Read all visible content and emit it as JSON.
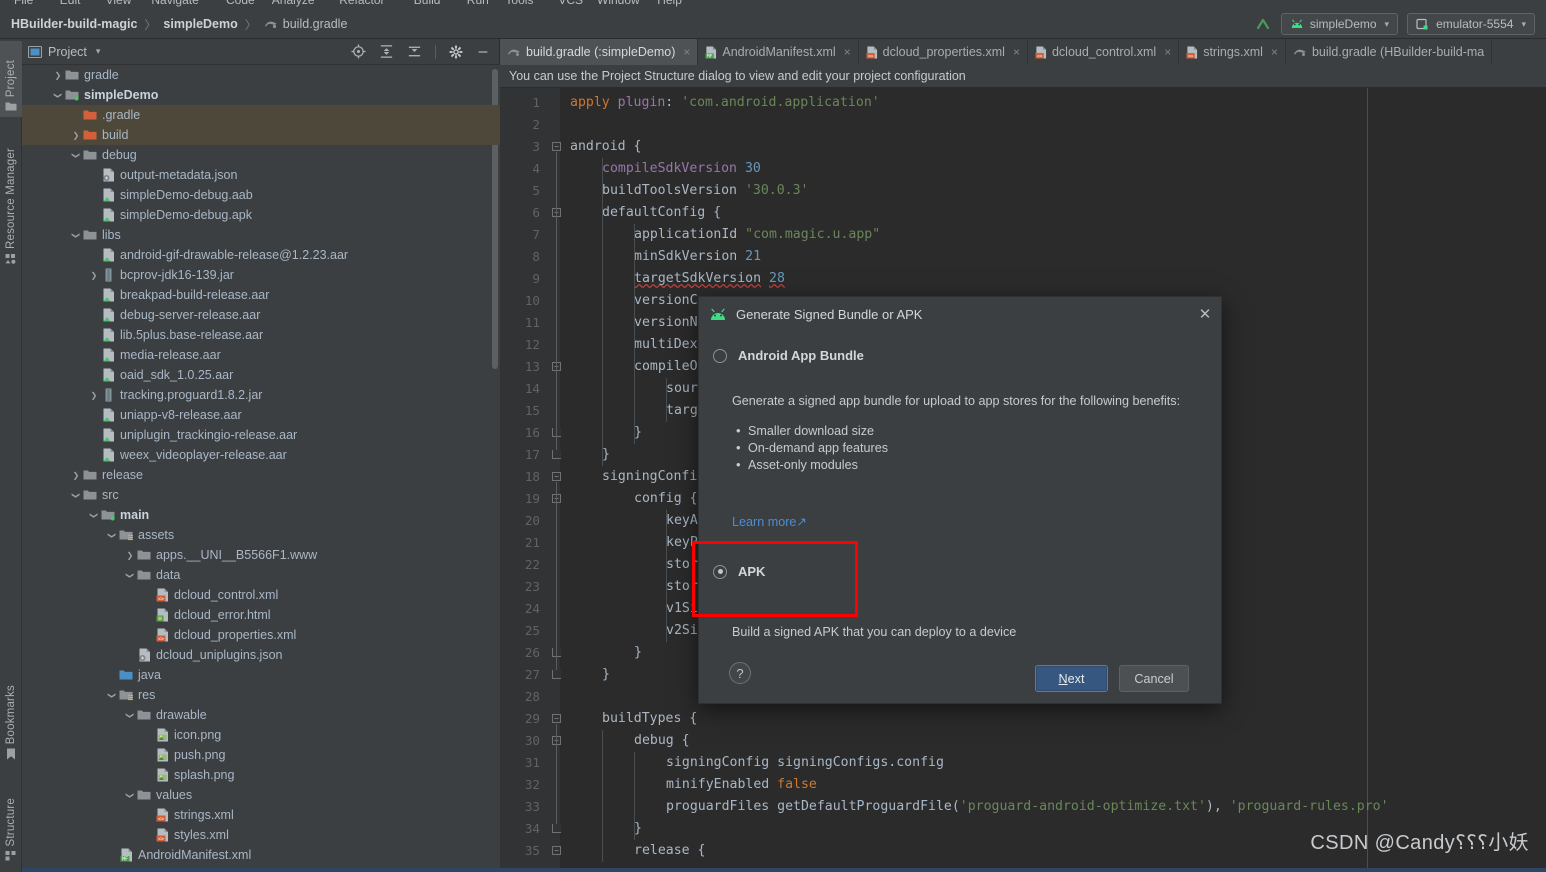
{
  "menu_sliver": [
    "File",
    "Edit",
    "View",
    "Navigate",
    "Code",
    "Analyze",
    "Refactor",
    "Build",
    "Run",
    "Tools",
    "VCS",
    "Window",
    "Help"
  ],
  "navbar": {
    "crumbs": [
      {
        "label": "HBuilder-build-magic",
        "bold": true,
        "icon": null
      },
      {
        "label": "simpleDemo",
        "bold": true,
        "icon": null
      },
      {
        "label": "build.gradle",
        "bold": false,
        "icon": "gradle-icon"
      }
    ],
    "separator": "〉",
    "run_icon": "run-arrow-icon",
    "app_selector": {
      "label": "simpleDemo",
      "icon": "android-icon",
      "caret": "▾"
    },
    "device_selector": {
      "label": "emulator-5554",
      "icon": "device-icon",
      "caret": "▾"
    }
  },
  "toolstrip": {
    "left_top": [
      {
        "label": "Project",
        "icon": "project-folder-icon",
        "active": true
      },
      {
        "label": "Resource Manager",
        "icon": "resource-manager-icon",
        "active": false
      }
    ],
    "left_bottom": [
      {
        "label": "Structure",
        "icon": "structure-icon",
        "active": false
      },
      {
        "label": "Bookmarks",
        "icon": "bookmark-icon",
        "active": false
      }
    ]
  },
  "project_panel": {
    "title": "Project",
    "caret": "▾",
    "view_icon": "project-view-icon",
    "header_icons": [
      "locate-icon",
      "expand-all-icon",
      "collapse-all-icon",
      "settings-gear-icon",
      "hide-panel-icon"
    ],
    "tree": [
      {
        "indent": 1,
        "arrow": "›",
        "icon": "folder",
        "label": "gradle",
        "bold": false,
        "selected": false
      },
      {
        "indent": 1,
        "arrow": "⌄",
        "icon": "module",
        "label": "simpleDemo",
        "bold": true,
        "selected": false
      },
      {
        "indent": 2,
        "arrow": "",
        "icon": "folder-orange",
        "label": ".gradle",
        "bold": false,
        "selected": true
      },
      {
        "indent": 2,
        "arrow": "›",
        "icon": "folder-orange",
        "label": "build",
        "bold": false,
        "selected": true
      },
      {
        "indent": 2,
        "arrow": "⌄",
        "icon": "folder",
        "label": "debug",
        "bold": false,
        "selected": false
      },
      {
        "indent": 3,
        "arrow": "",
        "icon": "json-file",
        "label": "output-metadata.json",
        "bold": false,
        "selected": false
      },
      {
        "indent": 3,
        "arrow": "",
        "icon": "aab-file",
        "label": "simpleDemo-debug.aab",
        "bold": false,
        "selected": false
      },
      {
        "indent": 3,
        "arrow": "",
        "icon": "apk-file",
        "label": "simpleDemo-debug.apk",
        "bold": false,
        "selected": false
      },
      {
        "indent": 2,
        "arrow": "⌄",
        "icon": "folder",
        "label": "libs",
        "bold": false,
        "selected": false
      },
      {
        "indent": 3,
        "arrow": "",
        "icon": "aar-file",
        "label": "android-gif-drawable-release@1.2.23.aar",
        "bold": false,
        "selected": false
      },
      {
        "indent": 3,
        "arrow": "›",
        "icon": "jar-file",
        "label": "bcprov-jdk16-139.jar",
        "bold": false,
        "selected": false
      },
      {
        "indent": 3,
        "arrow": "",
        "icon": "aar-file",
        "label": "breakpad-build-release.aar",
        "bold": false,
        "selected": false
      },
      {
        "indent": 3,
        "arrow": "",
        "icon": "aar-file",
        "label": "debug-server-release.aar",
        "bold": false,
        "selected": false
      },
      {
        "indent": 3,
        "arrow": "",
        "icon": "aar-file",
        "label": "lib.5plus.base-release.aar",
        "bold": false,
        "selected": false
      },
      {
        "indent": 3,
        "arrow": "",
        "icon": "aar-file",
        "label": "media-release.aar",
        "bold": false,
        "selected": false
      },
      {
        "indent": 3,
        "arrow": "",
        "icon": "aar-file",
        "label": "oaid_sdk_1.0.25.aar",
        "bold": false,
        "selected": false
      },
      {
        "indent": 3,
        "arrow": "›",
        "icon": "jar-file",
        "label": "tracking.proguard1.8.2.jar",
        "bold": false,
        "selected": false
      },
      {
        "indent": 3,
        "arrow": "",
        "icon": "aar-file",
        "label": "uniapp-v8-release.aar",
        "bold": false,
        "selected": false
      },
      {
        "indent": 3,
        "arrow": "",
        "icon": "aar-file",
        "label": "uniplugin_trackingio-release.aar",
        "bold": false,
        "selected": false
      },
      {
        "indent": 3,
        "arrow": "",
        "icon": "aar-file",
        "label": "weex_videoplayer-release.aar",
        "bold": false,
        "selected": false
      },
      {
        "indent": 2,
        "arrow": "›",
        "icon": "folder",
        "label": "release",
        "bold": false,
        "selected": false
      },
      {
        "indent": 2,
        "arrow": "⌄",
        "icon": "folder",
        "label": "src",
        "bold": false,
        "selected": false
      },
      {
        "indent": 3,
        "arrow": "⌄",
        "icon": "module",
        "label": "main",
        "bold": true,
        "selected": false
      },
      {
        "indent": 4,
        "arrow": "⌄",
        "icon": "assets-folder",
        "label": "assets",
        "bold": false,
        "selected": false
      },
      {
        "indent": 5,
        "arrow": "›",
        "icon": "folder",
        "label": "apps.__UNI__B5566F1.www",
        "bold": false,
        "selected": false
      },
      {
        "indent": 5,
        "arrow": "⌄",
        "icon": "folder",
        "label": "data",
        "bold": false,
        "selected": false
      },
      {
        "indent": 6,
        "arrow": "",
        "icon": "xml-file",
        "label": "dcloud_control.xml",
        "bold": false,
        "selected": false
      },
      {
        "indent": 6,
        "arrow": "",
        "icon": "html-file",
        "label": "dcloud_error.html",
        "bold": false,
        "selected": false
      },
      {
        "indent": 6,
        "arrow": "",
        "icon": "xml-file",
        "label": "dcloud_properties.xml",
        "bold": false,
        "selected": false
      },
      {
        "indent": 5,
        "arrow": "",
        "icon": "json-file",
        "label": "dcloud_uniplugins.json",
        "bold": false,
        "selected": false
      },
      {
        "indent": 4,
        "arrow": "",
        "icon": "source-folder",
        "label": "java",
        "bold": false,
        "selected": false
      },
      {
        "indent": 4,
        "arrow": "⌄",
        "icon": "res-folder",
        "label": "res",
        "bold": false,
        "selected": false
      },
      {
        "indent": 5,
        "arrow": "⌄",
        "icon": "folder",
        "label": "drawable",
        "bold": false,
        "selected": false
      },
      {
        "indent": 6,
        "arrow": "",
        "icon": "png-file",
        "label": "icon.png",
        "bold": false,
        "selected": false
      },
      {
        "indent": 6,
        "arrow": "",
        "icon": "png-file",
        "label": "push.png",
        "bold": false,
        "selected": false
      },
      {
        "indent": 6,
        "arrow": "",
        "icon": "png-file",
        "label": "splash.png",
        "bold": false,
        "selected": false
      },
      {
        "indent": 5,
        "arrow": "⌄",
        "icon": "folder",
        "label": "values",
        "bold": false,
        "selected": false
      },
      {
        "indent": 6,
        "arrow": "",
        "icon": "xml-file",
        "label": "strings.xml",
        "bold": false,
        "selected": false
      },
      {
        "indent": 6,
        "arrow": "",
        "icon": "xml-file",
        "label": "styles.xml",
        "bold": false,
        "selected": false
      },
      {
        "indent": 4,
        "arrow": "",
        "icon": "manifest-file",
        "label": "AndroidManifest.xml",
        "bold": false,
        "selected": false
      }
    ]
  },
  "editor": {
    "tabs": [
      {
        "label": "build.gradle (:simpleDemo)",
        "icon": "gradle-icon",
        "active": true,
        "close": "×"
      },
      {
        "label": "AndroidManifest.xml",
        "icon": "manifest-file",
        "active": false,
        "close": "×"
      },
      {
        "label": "dcloud_properties.xml",
        "icon": "xml-file",
        "active": false,
        "close": "×"
      },
      {
        "label": "dcloud_control.xml",
        "icon": "xml-file",
        "active": false,
        "close": "×"
      },
      {
        "label": "strings.xml",
        "icon": "xml-file",
        "active": false,
        "close": "×"
      },
      {
        "label": "build.gradle (HBuilder-build-ma",
        "icon": "gradle-icon",
        "active": false,
        "close": ""
      }
    ],
    "hint": "You can use the Project Structure dialog to view and edit your project configuration",
    "lines": [
      {
        "n": 1,
        "indent": 0,
        "html": "<span class=\"k\">apply</span> <span class=\"p\">plugin</span><span class=\"d\">:</span> <span class=\"s\">'com.android.application'</span>"
      },
      {
        "n": 2,
        "indent": 0,
        "html": ""
      },
      {
        "n": 3,
        "indent": 0,
        "html": "<span class=\"d\">android {</span>"
      },
      {
        "n": 4,
        "indent": 1,
        "html": "<span class=\"p\">compileSdkVersion</span> <span class=\"n\">30</span>"
      },
      {
        "n": 5,
        "indent": 1,
        "html": "<span class=\"d\">buildToolsVersion</span> <span class=\"s\">'30.0.3'</span>"
      },
      {
        "n": 6,
        "indent": 1,
        "html": "<span class=\"d\">defaultConfig {</span>"
      },
      {
        "n": 7,
        "indent": 2,
        "html": "<span class=\"d\">applicationId</span> <span class=\"s\">\"com.magic.u.app\"</span>"
      },
      {
        "n": 8,
        "indent": 2,
        "html": "<span class=\"d\">minSdkVersion</span> <span class=\"n\">21</span>"
      },
      {
        "n": 9,
        "indent": 2,
        "html": "<span class=\"d squiggle\">targetSdkVersion</span> <span class=\"n squiggle\">28</span>"
      },
      {
        "n": 10,
        "indent": 2,
        "html": "<span class=\"d\">versionCo</span>"
      },
      {
        "n": 11,
        "indent": 2,
        "html": "<span class=\"d\">versionNa</span>"
      },
      {
        "n": 12,
        "indent": 2,
        "html": "<span class=\"d\">multiDexE</span>"
      },
      {
        "n": 13,
        "indent": 2,
        "html": "<span class=\"d\">compileOp</span>"
      },
      {
        "n": 14,
        "indent": 3,
        "html": "<span class=\"d\">sourc</span>"
      },
      {
        "n": 15,
        "indent": 3,
        "html": "<span class=\"d\">targe</span>"
      },
      {
        "n": 16,
        "indent": 2,
        "html": "<span class=\"d\">}</span>"
      },
      {
        "n": 17,
        "indent": 1,
        "html": "<span class=\"d\">}</span>"
      },
      {
        "n": 18,
        "indent": 1,
        "html": "<span class=\"d\">signingConfig</span>"
      },
      {
        "n": 19,
        "indent": 2,
        "html": "<span class=\"d\">config {</span>"
      },
      {
        "n": 20,
        "indent": 3,
        "html": "<span class=\"d\">keyAl</span>"
      },
      {
        "n": 21,
        "indent": 3,
        "html": "<span class=\"d\">keyPa</span>"
      },
      {
        "n": 22,
        "indent": 3,
        "html": "<span class=\"d\">store</span>"
      },
      {
        "n": 23,
        "indent": 3,
        "html": "<span class=\"d\">store</span>"
      },
      {
        "n": 24,
        "indent": 3,
        "html": "<span class=\"d\">v1Sig</span>"
      },
      {
        "n": 25,
        "indent": 3,
        "html": "<span class=\"d\">v2Sig</span>"
      },
      {
        "n": 26,
        "indent": 2,
        "html": "<span class=\"d\">}</span>"
      },
      {
        "n": 27,
        "indent": 1,
        "html": "<span class=\"d\">}</span>"
      },
      {
        "n": 28,
        "indent": 0,
        "html": ""
      },
      {
        "n": 29,
        "indent": 1,
        "html": "<span class=\"d\">buildTypes {</span>"
      },
      {
        "n": 30,
        "indent": 2,
        "html": "<span class=\"d\">debug {</span>"
      },
      {
        "n": 31,
        "indent": 3,
        "html": "<span class=\"d\">signingConfig signingConfigs.config</span>"
      },
      {
        "n": 32,
        "indent": 3,
        "html": "<span class=\"d\">minifyEnabled</span> <span class=\"k\">false</span>"
      },
      {
        "n": 33,
        "indent": 3,
        "html": "<span class=\"d\">proguardFiles getDefaultProguardFile(</span><span class=\"s\">'proguard-android-optimize.txt'</span><span class=\"d\">), </span><span class=\"s\">'proguard-rules.pro'</span>"
      },
      {
        "n": 34,
        "indent": 2,
        "html": "<span class=\"d\">}</span>"
      },
      {
        "n": 35,
        "indent": 2,
        "html": "<span class=\"d\">release {</span>"
      }
    ]
  },
  "dialog": {
    "title": "Generate Signed Bundle or APK",
    "title_icon": "android-icon",
    "close": "✕",
    "option_bundle": {
      "label": "Android App Bundle",
      "selected": false,
      "description": "Generate a signed app bundle for upload to app stores for the following benefits:",
      "benefits": [
        "Smaller download size",
        "On-demand app features",
        "Asset-only modules"
      ],
      "learn_more": "Learn more",
      "learn_more_arrow": "↗"
    },
    "option_apk": {
      "label": "APK",
      "selected": true,
      "description": "Build a signed APK that you can deploy to a device",
      "highlight_color": "#fe0000"
    },
    "help_label": "?",
    "next_label": "Next",
    "next_mnemonic": "N",
    "cancel_label": "Cancel"
  },
  "watermark": "CSDN @Candy⸮⸮⸮小妖"
}
